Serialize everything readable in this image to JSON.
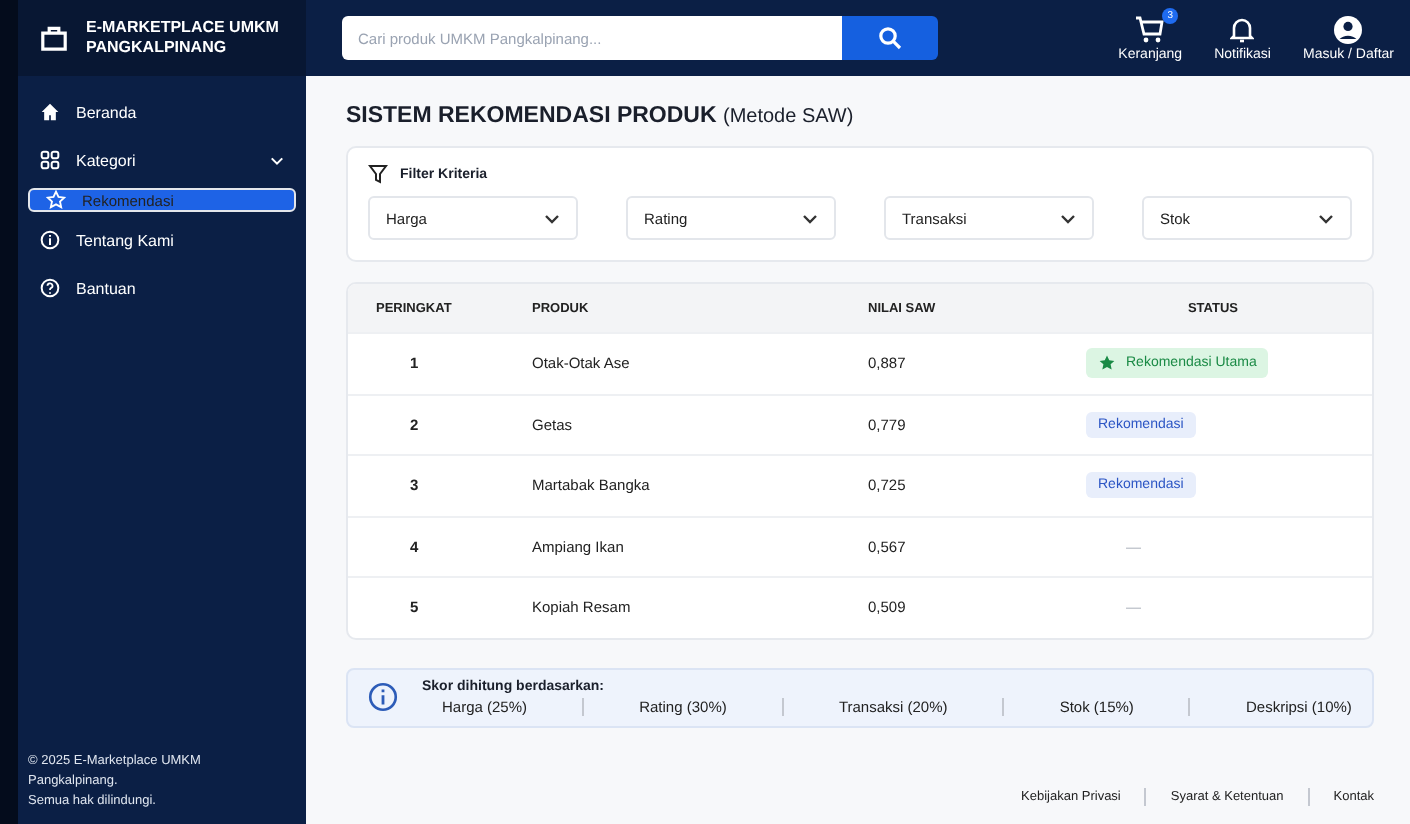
{
  "brand": {
    "line1": "E-MARKETPLACE UMKM",
    "line2": "PANGKALPINANG"
  },
  "search": {
    "placeholder": "Cari produk UMKM Pangkalpinang..."
  },
  "top_actions": [
    {
      "kind": "cart",
      "label": "Keranjang",
      "badge": "3"
    },
    {
      "kind": "bell",
      "label": "Notifikasi"
    },
    {
      "kind": "user",
      "label": "Masuk / Daftar"
    }
  ],
  "sidebar": {
    "items": [
      {
        "kind": "home",
        "label": "Beranda",
        "selected": false,
        "expandable": false
      },
      {
        "kind": "grid",
        "label": "Kategori",
        "selected": false,
        "expandable": true
      },
      {
        "kind": "star",
        "label": "Rekomendasi",
        "selected": true,
        "expandable": false
      },
      {
        "kind": "info",
        "label": "Tentang Kami",
        "selected": false,
        "expandable": false
      },
      {
        "kind": "help",
        "label": "Bantuan",
        "selected": false,
        "expandable": false
      }
    ],
    "footer": [
      "© 2025 E-Marketplace UMKM",
      "Pangkalpinang.",
      "Semua hak dilindungi."
    ]
  },
  "page_title": {
    "main": "SISTEM REKOMENDASI PRODUK",
    "sub": "(Metode SAW)"
  },
  "filter": {
    "title": "Filter Kriteria",
    "selects": [
      "Harga",
      "Rating",
      "Transaksi",
      "Stok"
    ]
  },
  "table": {
    "columns": [
      "PERINGKAT",
      "PRODUK",
      "NILAI SAW",
      "STATUS"
    ],
    "rows": [
      {
        "rank": "1",
        "product": "Otak-Otak Ase",
        "score": "0,887",
        "status": "Rekomendasi Utama",
        "kind": "primary"
      },
      {
        "rank": "2",
        "product": "Getas",
        "score": "0,779",
        "status": "Rekomendasi",
        "kind": "normal"
      },
      {
        "rank": "3",
        "product": "Martabak Bangka",
        "score": "0,725",
        "status": "Rekomendasi",
        "kind": "normal"
      },
      {
        "rank": "4",
        "product": "Ampiang Ikan",
        "score": "0,567",
        "status": "—",
        "kind": "none"
      },
      {
        "rank": "5",
        "product": "Kopiah Resam",
        "score": "0,509",
        "status": "—",
        "kind": "none"
      }
    ]
  },
  "info": {
    "title": "Skor dihitung berdasarkan:",
    "weights": [
      "Harga (25%)",
      "Rating (30%)",
      "Transaksi (20%)",
      "Stok (15%)",
      "Deskripsi (10%)"
    ]
  },
  "footer_links": [
    "Kebijakan Privasi",
    "Syarat & Ketentuan",
    "Kontak"
  ]
}
